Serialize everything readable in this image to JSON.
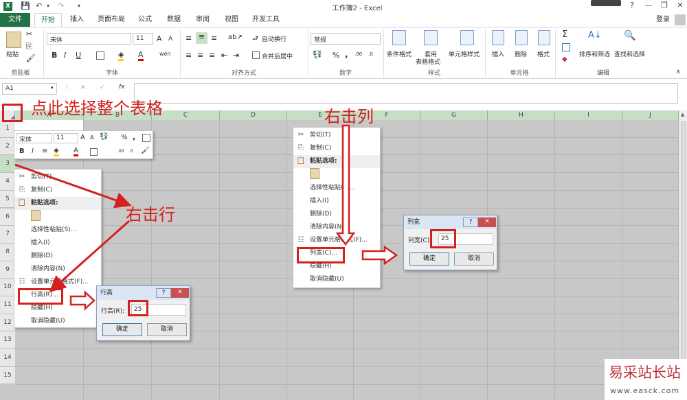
{
  "window": {
    "title": "工作簿2 - Excel",
    "signin": "登录",
    "help": "?",
    "min": "—",
    "restore": "❐",
    "close": "✕"
  },
  "tabs": [
    "文件",
    "开始",
    "插入",
    "页面布局",
    "公式",
    "数据",
    "审阅",
    "视图",
    "开发工具"
  ],
  "ribbon": {
    "clipboard": {
      "paste": "粘贴",
      "label": "剪贴板"
    },
    "font": {
      "name": "宋体",
      "size": "11",
      "grow": "A",
      "shrink": "A",
      "bold": "B",
      "italic": "I",
      "underline": "U",
      "color_a": "A",
      "wen": "wén",
      "label": "字体"
    },
    "align": {
      "wrap": "自动换行",
      "merge": "合并后居中",
      "label": "对齐方式"
    },
    "number": {
      "format": "常规",
      "percent": "%",
      "comma": ",",
      "label": "数字"
    },
    "styles": {
      "cond": "条件格式",
      "table_a": "套用",
      "table_b": "表格格式",
      "cell": "单元格样式",
      "label": "样式"
    },
    "cells": {
      "insert": "插入",
      "delete": "删除",
      "format": "格式",
      "label": "单元格"
    },
    "editing": {
      "sum": "Σ",
      "sort": "排序和筛选",
      "find": "查找和选择",
      "label": "编辑"
    }
  },
  "formula_bar": {
    "name_box": "A1",
    "cancel": "✕",
    "enter": "✓",
    "fx": "fx"
  },
  "columns": [
    "A",
    "B",
    "C",
    "D",
    "E",
    "F",
    "G",
    "H",
    "I",
    "J"
  ],
  "rows": [
    "1",
    "2",
    "3",
    "4",
    "5",
    "6",
    "7",
    "8",
    "9",
    "10",
    "11",
    "12",
    "13",
    "14",
    "15"
  ],
  "mini_toolbar": {
    "font": "宋体",
    "size": "11",
    "grow": "A",
    "shrink": "A",
    "percent": "%",
    "comma": ",",
    "bold": "B",
    "italic": "I",
    "align": "≡",
    "color_a": "A"
  },
  "row_menu": {
    "items": [
      "剪切(T)",
      "复制(C)",
      "粘贴选项:",
      "选择性粘贴(S)...",
      "插入(I)",
      "删除(D)",
      "清除内容(N)",
      "设置单元格格式(F)...",
      "行高(R)...",
      "隐藏(H)",
      "取消隐藏(U)"
    ]
  },
  "col_menu": {
    "items": [
      "剪切(T)",
      "复制(C)",
      "粘贴选项:",
      "选择性粘贴(S)...",
      "插入(I)",
      "删除(D)",
      "清除内容(N)",
      "设置单元格格式(F)...",
      "列宽(C)...",
      "隐藏(H)",
      "取消隐藏(U)"
    ]
  },
  "row_dialog": {
    "title": "行高",
    "help": "?",
    "close": "✕",
    "label": "行高(R):",
    "value": "25",
    "ok": "确定",
    "cancel": "取消"
  },
  "col_dialog": {
    "title": "列宽",
    "help": "?",
    "close": "✕",
    "label": "列宽(C):",
    "value": "25",
    "ok": "确定",
    "cancel": "取消"
  },
  "annotations": {
    "select_all": "点此选择整个表格",
    "right_click_col": "右击列",
    "right_click_row": "右击行"
  },
  "watermark": {
    "title": "易采站长站",
    "url": "www.easck.com"
  },
  "colors": {
    "excel_green": "#217346",
    "annotation_red": "#d42020",
    "grid_gray": "#c8c8c8"
  }
}
